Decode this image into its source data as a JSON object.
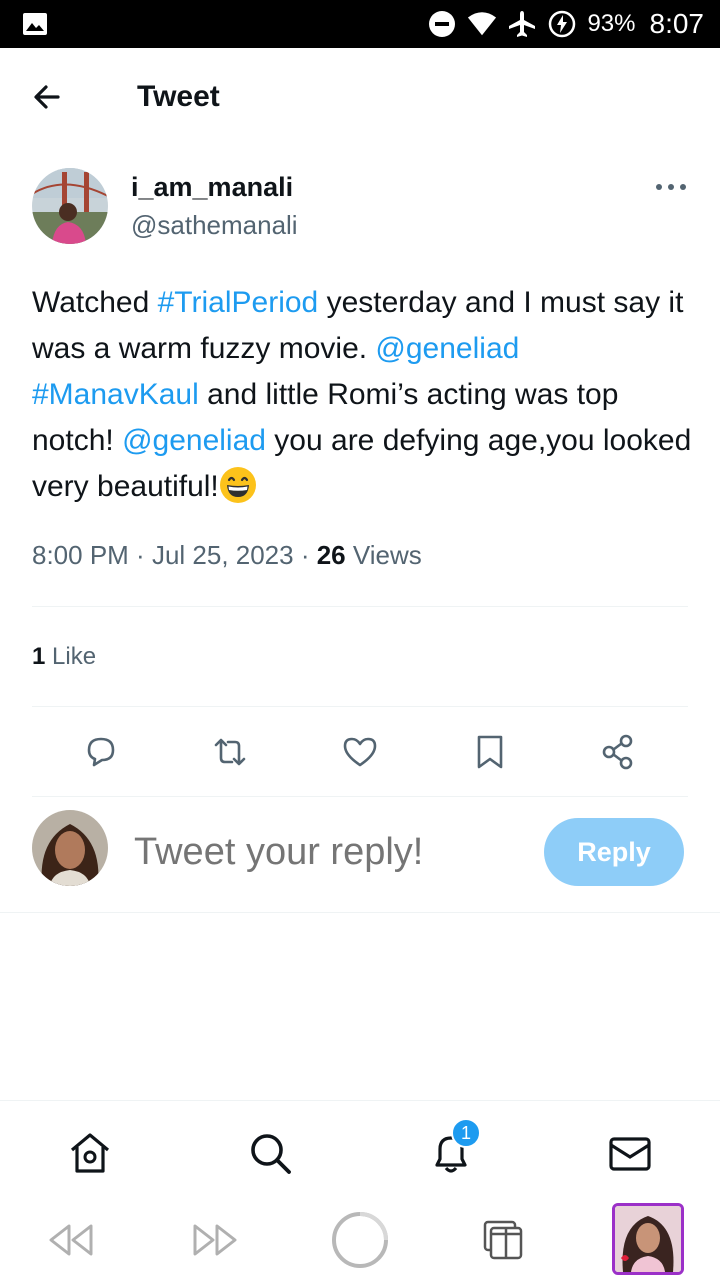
{
  "status_bar": {
    "battery": "93%",
    "time": "8:07"
  },
  "header": {
    "title": "Tweet"
  },
  "tweet": {
    "display_name": "i_am_manali",
    "handle": "@sathemanali",
    "text_parts": {
      "p1": "Watched ",
      "h1": "#TrialPeriod",
      "p2": " yesterday and I must say it was a warm fuzzy movie. ",
      "m1": "@geneliad",
      "p3": " ",
      "h2": "#ManavKaul",
      "p4": " and little Romi’s acting was top notch! ",
      "m2": "@geneliad",
      "p5": " you are defying age,you looked very beautiful!"
    },
    "time": "8:00 PM",
    "sep1": " · ",
    "date": "Jul 25, 2023",
    "sep2": " · ",
    "views_count": "26",
    "views_label": " Views",
    "likes_count": "1",
    "likes_label": " Like"
  },
  "reply": {
    "placeholder": "Tweet your reply!",
    "button_label": "Reply"
  },
  "bottom_nav": {
    "notification_badge": "1",
    "items": [
      "home-icon",
      "search-icon",
      "notifications-icon",
      "messages-icon"
    ]
  },
  "colors": {
    "link": "#1d9bf0",
    "reply_button": "#8ecdf8",
    "secondary_text": "#536471"
  }
}
